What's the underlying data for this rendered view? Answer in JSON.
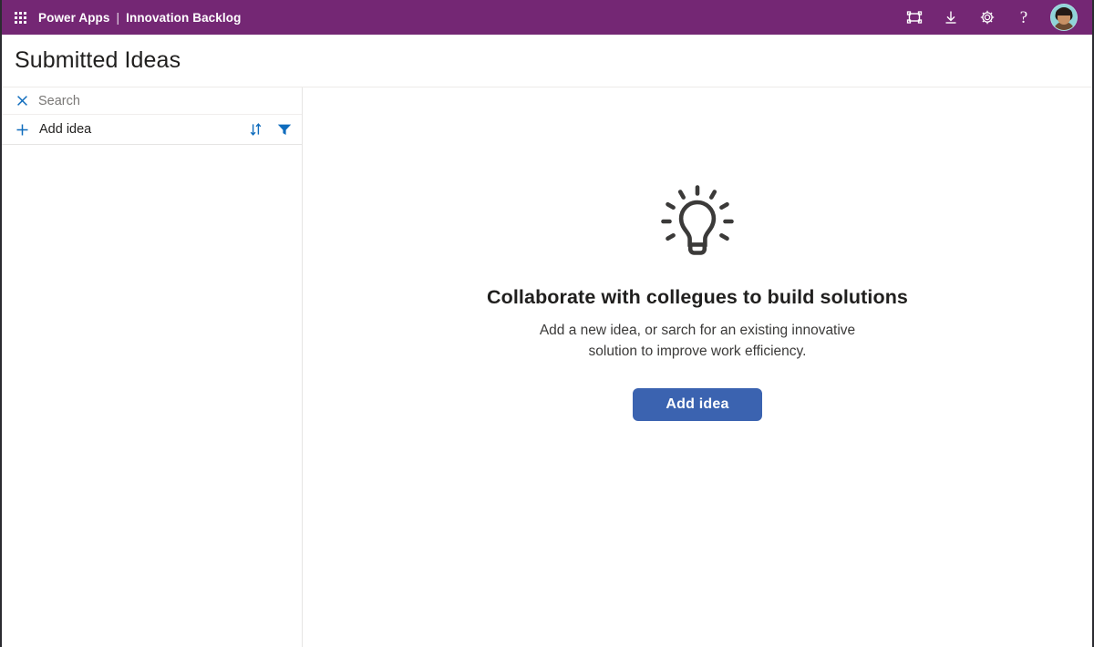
{
  "topbar": {
    "waffle_icon": "app-launcher-waffle-icon",
    "product": "Power Apps",
    "separator": "|",
    "app_name": "Innovation Backlog",
    "actions": [
      {
        "icon": "fit-to-screen-icon",
        "label": "Fit to screen"
      },
      {
        "icon": "download-icon",
        "label": "Download"
      },
      {
        "icon": "gear-icon",
        "label": "Settings"
      },
      {
        "icon": "help-icon",
        "label": "?"
      }
    ],
    "avatar_label": "Account manager"
  },
  "page": {
    "title": "Submitted Ideas"
  },
  "sidebar": {
    "search": {
      "clear_icon": "close-icon",
      "value": "",
      "placeholder": "Search"
    },
    "add_row": {
      "plus_icon": "plus-icon",
      "label": "Add idea",
      "sort_icon": "sort-icon",
      "filter_icon": "filter-icon"
    },
    "items": []
  },
  "empty_state": {
    "illustration": "lightbulb-icon",
    "title": "Collaborate with collegues to build solutions",
    "description": "Add a new idea, or sarch for an existing innovative solution to improve work efficiency.",
    "button_label": "Add idea"
  },
  "colors": {
    "brand_purple": "#742774",
    "accent_blue": "#0f6cbd",
    "button_blue": "#3b63b0",
    "text_primary": "#201f1e",
    "text_secondary": "#3b3a39",
    "placeholder": "#797775",
    "divider": "#e6e5e4"
  }
}
